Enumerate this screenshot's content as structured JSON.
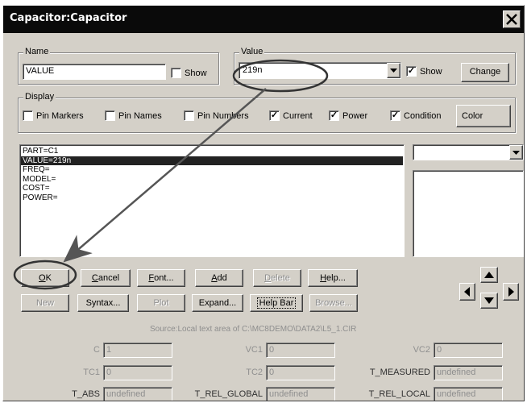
{
  "window": {
    "title": "Capacitor:Capacitor"
  },
  "name_group": {
    "label": "Name",
    "value": "VALUE",
    "show_label": "Show",
    "show_checked": false
  },
  "value_group": {
    "label": "Value",
    "value": "219n",
    "show_label": "Show",
    "show_checked": true,
    "change_label": "Change"
  },
  "display_group": {
    "label": "Display",
    "checkboxes": [
      {
        "label": "Pin Markers",
        "checked": false
      },
      {
        "label": "Pin Names",
        "checked": false
      },
      {
        "label": "Pin Numbers",
        "checked": false
      },
      {
        "label": "Current",
        "checked": true
      },
      {
        "label": "Power",
        "checked": true
      },
      {
        "label": "Condition",
        "checked": true
      }
    ],
    "color_label": "Color"
  },
  "properties": {
    "lines": [
      "PART=C1",
      "VALUE=219n",
      "FREQ=",
      "MODEL=",
      "COST=",
      "POWER="
    ],
    "selected_index": 1
  },
  "buttons_row1": [
    {
      "pre": "",
      "ul": "O",
      "post": "K",
      "enabled": true
    },
    {
      "pre": "",
      "ul": "C",
      "post": "ancel",
      "enabled": true
    },
    {
      "pre": "",
      "ul": "F",
      "post": "ont...",
      "enabled": true
    },
    {
      "pre": "",
      "ul": "A",
      "post": "dd",
      "enabled": true
    },
    {
      "pre": "",
      "ul": "D",
      "post": "elete",
      "enabled": false
    },
    {
      "pre": "",
      "ul": "H",
      "post": "elp...",
      "enabled": true
    }
  ],
  "buttons_row2": [
    {
      "label": "New",
      "enabled": false
    },
    {
      "label": "Syntax...",
      "enabled": true
    },
    {
      "label": "Plot",
      "enabled": false
    },
    {
      "label": "Expand...",
      "enabled": true
    },
    {
      "label": "Help Bar",
      "enabled": true
    },
    {
      "label": "Browse...",
      "enabled": false
    }
  ],
  "source_text": "Source:Local text area of C:\\MC8DEMO\\DATA2\\L5_1.CIR",
  "params": [
    {
      "label": "C",
      "value": "1"
    },
    {
      "label": "VC1",
      "value": "0"
    },
    {
      "label": "VC2",
      "value": "0"
    },
    {
      "label": "TC1",
      "value": "0"
    },
    {
      "label": "TC2",
      "value": "0"
    },
    {
      "label": "T_MEASURED",
      "value": "undefined"
    },
    {
      "label": "T_ABS",
      "value": "undefined"
    },
    {
      "label": "T_REL_GLOBAL",
      "value": "undefined"
    },
    {
      "label": "T_REL_LOCAL",
      "value": "undefined"
    }
  ],
  "icons": {
    "close": "close-icon",
    "dropdown": "chevron-down-icon",
    "nav": [
      "arrow-up-icon",
      "arrow-left-icon",
      "arrow-down-icon",
      "arrow-right-icon"
    ]
  },
  "colors": {
    "titlebar": "#0a0a0a",
    "face": "#d4d0c8",
    "selection": "#222222"
  }
}
